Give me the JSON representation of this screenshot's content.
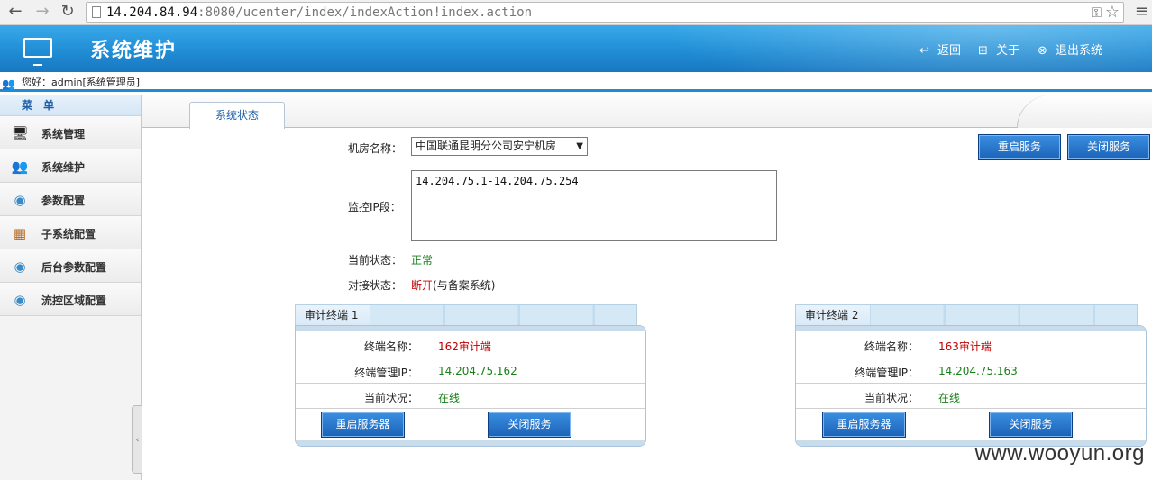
{
  "browser": {
    "url_host": "14.204.84.94",
    "url_rest": ":8080/ucenter/index/indexAction!index.action"
  },
  "header": {
    "title": "系统维护",
    "links": [
      {
        "label": "返回",
        "icon": "back-icon"
      },
      {
        "label": "关于",
        "icon": "windows-icon"
      },
      {
        "label": "退出系统",
        "icon": "close-circle-icon"
      }
    ]
  },
  "greeting": "您好：admin[系统管理员]",
  "sidebar": {
    "heading": "菜 单",
    "items": [
      {
        "label": "系统管理",
        "icon": "monitor-icon"
      },
      {
        "label": "系统维护",
        "icon": "users-icon"
      },
      {
        "label": "参数配置",
        "icon": "disc-icon"
      },
      {
        "label": "子系统配置",
        "icon": "toolbox-icon"
      },
      {
        "label": "后台参数配置",
        "icon": "disc-icon"
      },
      {
        "label": "流控区域配置",
        "icon": "disc-icon"
      }
    ]
  },
  "tabs": [
    {
      "label": "系统状态"
    }
  ],
  "form": {
    "room_label": "机房名称：",
    "room_value": "中国联通昆明分公司安宁机房",
    "ip_label": "监控IP段：",
    "ip_value": "14.204.75.1-14.204.75.254",
    "status_label": "当前状态：",
    "status_value": "正常",
    "link_label": "对接状态：",
    "link_value": "断开",
    "link_suffix": "(与备案系统)",
    "restart_service": "重启服务",
    "stop_service": "关闭服务"
  },
  "terminals": [
    {
      "title": "审计终端 1",
      "name_label": "终端名称：",
      "name_value": "162审计端",
      "ip_label": "终端管理IP：",
      "ip_value": "14.204.75.162",
      "state_label": "当前状况：",
      "state_value": "在线",
      "restart_label": "重启服务器",
      "stop_label": "关闭服务"
    },
    {
      "title": "审计终端 2",
      "name_label": "终端名称：",
      "name_value": "163审计端",
      "ip_label": "终端管理IP：",
      "ip_value": "14.204.75.163",
      "state_label": "当前状况：",
      "state_value": "在线",
      "restart_label": "重启服务器",
      "stop_label": "关闭服务"
    }
  ],
  "watermark": "www.wooyun.org",
  "colors": {
    "header_blue": "#1f8bd3",
    "status_green": "#1a7f1a",
    "status_red": "#c00000",
    "button_blue": "#1a62b8"
  }
}
